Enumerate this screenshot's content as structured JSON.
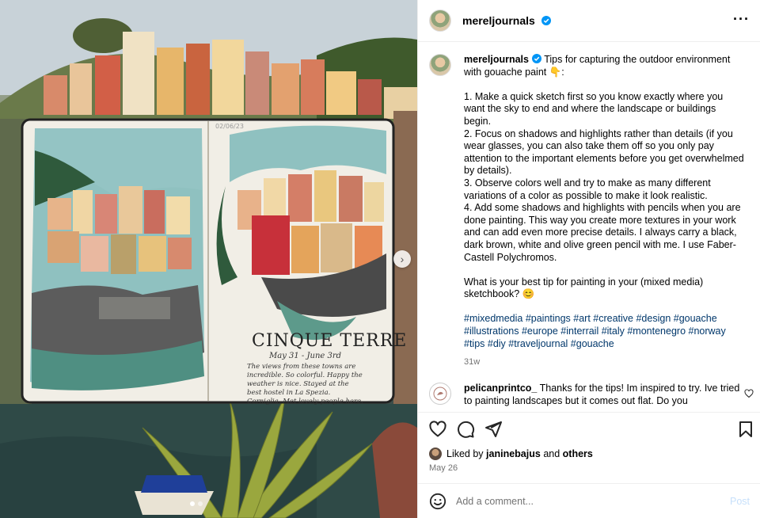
{
  "post": {
    "username": "mereljournals",
    "verified": true,
    "caption": "Tips for capturing the outdoor environment with gouache paint 👇:\n\n1. Make a quick sketch first so you know exactly where you want the sky to end and where the landscape or buildings begin.\n2. Focus on shadows and highlights rather than details (if you wear glasses, you can also take them off so you only pay attention to the important elements before you get overwhelmed by details).\n3. Observe colors well and try to make as many different variations of a color as possible to make it look realistic.\n4. Add some shadows and highlights with pencils when you are done painting. This way you create more textures in your work and can add even more precise details. I always carry a black, dark brown, white and olive green pencil with me. I use Faber-Castell Polychromos.\n\nWhat is your best tip for painting in your (mixed media) sketchbook? 😊",
    "hashtags": "#mixedmedia #paintings #art #creative #design #gouache #illustrations #europe #interrail #italy #montenegro #norway #tips #diy #traveljournal #gouache",
    "age": "31w"
  },
  "comment": {
    "username": "pelicanprintco_",
    "text": "Thanks for the tips! Im inspired to try. Ive tried to painting landscapes but it comes out flat. Do you"
  },
  "likes": {
    "prefix": "Liked by",
    "user": "janinebajus",
    "joiner": "and",
    "others": "others"
  },
  "date": "May 26",
  "comment_box": {
    "placeholder": "Add a comment...",
    "post_label": "Post"
  },
  "image": {
    "sketch_title": "CINQUE TERRE",
    "sketch_dates": "May 31 - June 3rd",
    "sketch_corner_date": "02/06/23",
    "sketch_note": "The views from these towns are incredible. So colorful. Happy the weather is nice. Stayed at the best hostel in La Spezia. Corniglia. Met lovely people here."
  },
  "colors": {
    "link": "#00376b",
    "verified": "#0095f6",
    "post_disabled": "#c7e0fb",
    "muted": "#737373"
  },
  "icons": [
    "verified-badge-icon",
    "more-options-icon",
    "heart-icon",
    "comment-icon",
    "share-icon",
    "save-icon",
    "emoji-icon",
    "chevron-right-icon"
  ]
}
